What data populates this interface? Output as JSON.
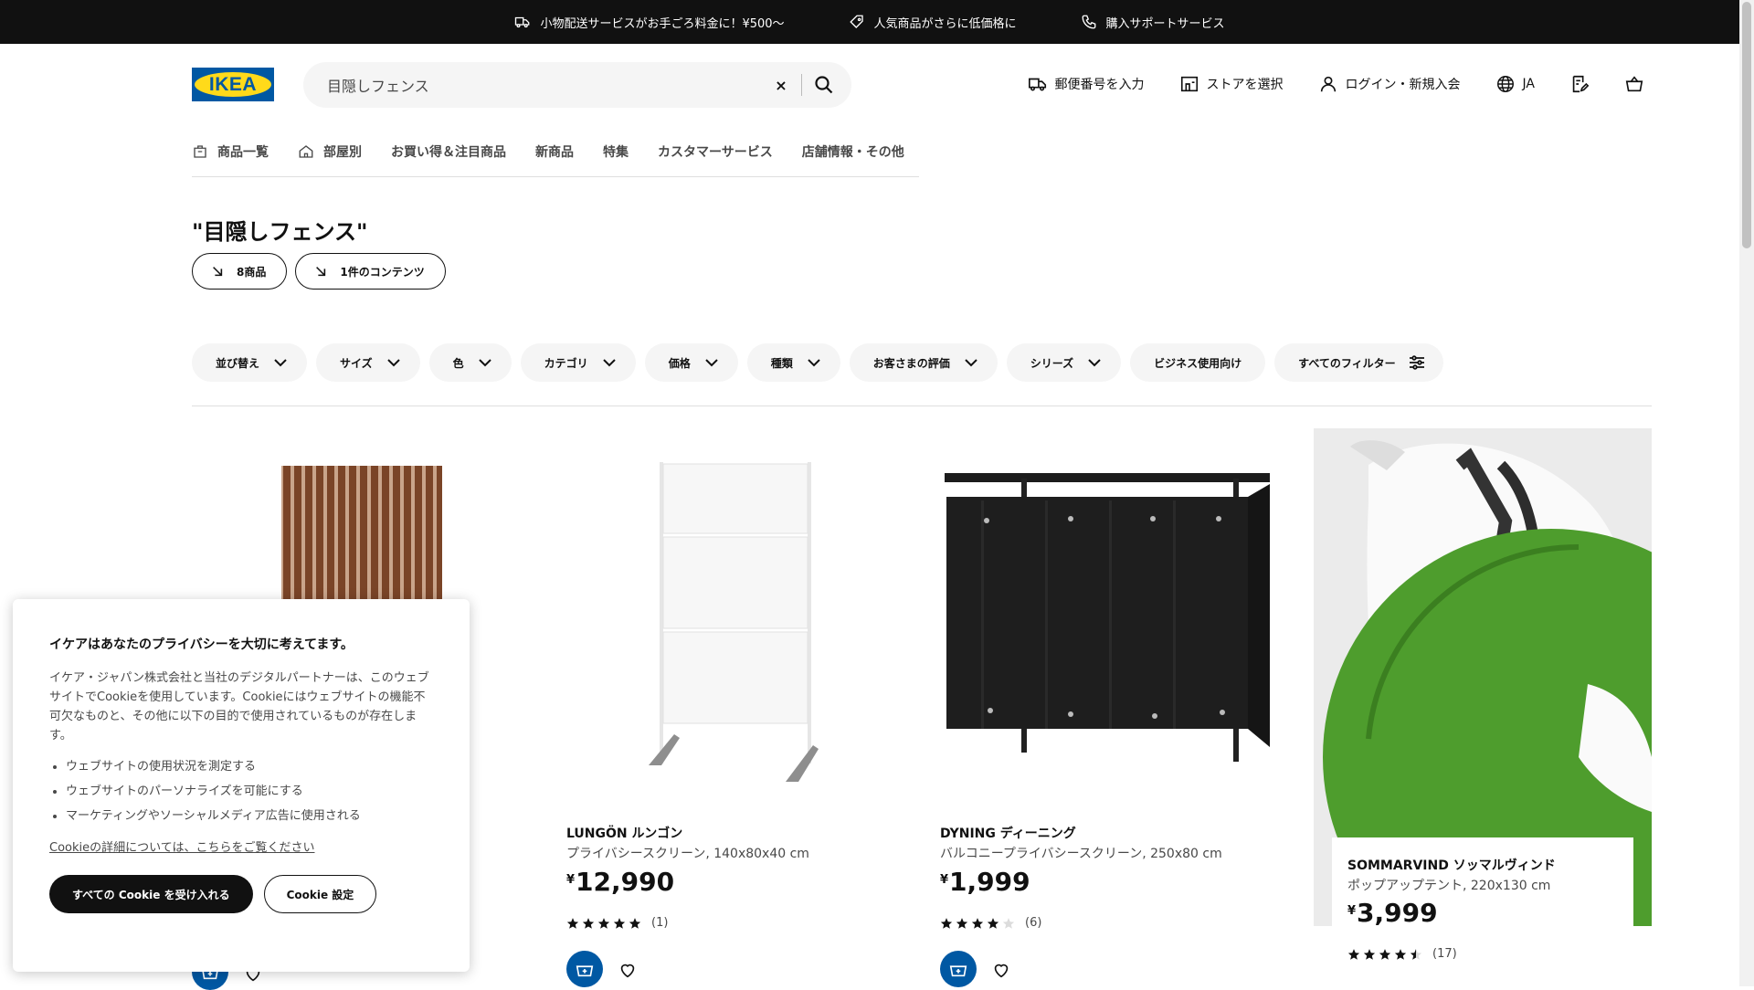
{
  "topbar": {
    "promos": [
      {
        "icon": "truck-icon",
        "text": "小物配送サービスがお手ごろ料金に！¥500〜"
      },
      {
        "icon": "price-tag-icon",
        "text": "人気商品がさらに低価格に"
      },
      {
        "icon": "phone-icon",
        "text": "購入サポートサービス"
      }
    ]
  },
  "header": {
    "logo_text": "IKEA",
    "search": {
      "value": "目隠しフェンス",
      "clear_glyph": "×"
    },
    "links": {
      "postcode": "郵便番号を入力",
      "store": "ストアを選択",
      "login": "ログイン・新規入会",
      "language": "JA"
    }
  },
  "nav": {
    "items": [
      "商品一覧",
      "部屋別",
      "お買い得＆注目商品",
      "新商品",
      "特集",
      "カスタマーサービス",
      "店舗情報・その他"
    ]
  },
  "results": {
    "title": "\"目隠しフェンス\"",
    "jump_products": "8商品",
    "jump_content": "1件のコンテンツ"
  },
  "filters": {
    "items": [
      "並び替え",
      "サイズ",
      "色",
      "カテゴリ",
      "価格",
      "種類",
      "お客さまの評価",
      "シリーズ"
    ],
    "business": "ビジネス使用向け",
    "all_filters": "すべてのフィルター"
  },
  "products": [
    {
      "name": "LUNGÖN ルンゴン",
      "desc": "プライバシースクリーン, 140x80x40 cm",
      "currency": "¥",
      "price": "12,990",
      "rating": 5,
      "reviews": "(1)"
    },
    {
      "name": "DYNING ディーニング",
      "desc": "バルコニープライバシースクリーン, 250x80 cm",
      "currency": "¥",
      "price": "1,999",
      "rating": 4,
      "reviews": "(6)"
    },
    {
      "name": "SOMMARVIND ソッマルヴィンド",
      "desc": "ポップアップテント, 220x130 cm",
      "currency": "¥",
      "price": "3,999",
      "rating": 4.5,
      "reviews": "(17)"
    }
  ],
  "cookie": {
    "title": "イケアはあなたのプライバシーを大切に考えてます。",
    "body": "イケア・ジャパン株式会社と当社のデジタルパートナーは、このウェブサイトでCookieを使用しています。Cookieにはウェブサイトの機能不可欠なものと、その他に以下の目的で使用されているものが存在します。",
    "bullets": [
      "ウェブサイトの使用状況を測定する",
      "ウェブサイトのパーソナライズを可能にする",
      "マーケティングやソーシャルメディア広告に使用される"
    ],
    "more_link": "Cookieの詳細については、こちらをご覧ください",
    "accept": "すべての Cookie を受け入れる",
    "settings": "Cookie 設定"
  },
  "colors": {
    "brand_blue": "#0058a3",
    "brand_yellow": "#ffda1a",
    "topbar": "#111111",
    "star": "#111111"
  }
}
